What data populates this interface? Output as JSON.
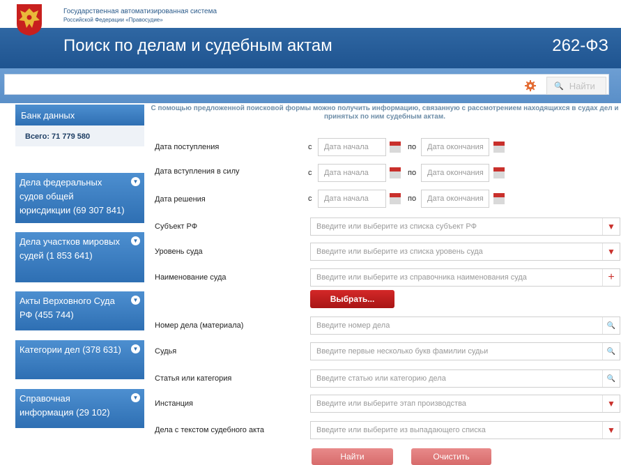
{
  "header": {
    "system_line1": "Государственная автоматизированная система",
    "system_line2": "Российской Федерации «Правосудие»",
    "title": "Поиск по делам и судебным актам",
    "law": "262-ФЗ"
  },
  "search": {
    "value": "",
    "find_label": "Найти",
    "colors": {
      "accent": "#c9302c",
      "title_bar": "#2a62a0",
      "sidebar": "#3a7dc2"
    }
  },
  "sidebar": {
    "header": "Банк данных",
    "total": "Всего: 71 779 580",
    "items": [
      {
        "label": "Дела федеральных судов общей юрисдикции (69 307 841)"
      },
      {
        "label": "Дела участков мировых судей (1 853 641)"
      },
      {
        "label": "Акты Верховного Суда РФ (455 744)"
      },
      {
        "label": "Категории дел (378 631)"
      },
      {
        "label": "Справочная информация (29 102)"
      }
    ]
  },
  "form": {
    "intro": "С помощью предложенной поисковой формы можно получить информацию, связанную с рассмотрением находящихся в судах дел и принятых по ним судебным актам.",
    "from": "с",
    "to": "по",
    "start_placeholder": "Дата начала",
    "end_placeholder": "Дата окончания",
    "date_rows": [
      {
        "label": "Дата поступления"
      },
      {
        "label": "Дата вступления в силу"
      },
      {
        "label": "Дата решения"
      }
    ],
    "fields": [
      {
        "label": "Субъект РФ",
        "placeholder": "Введите или выберите из списка субъект РФ",
        "icon": "dropdown-arrow"
      },
      {
        "label": "Уровень суда",
        "placeholder": "Введите или выберите из списка уровень суда",
        "icon": "dropdown-arrow"
      },
      {
        "label": "Наименование суда",
        "placeholder": "Введите или выберите из справочника наименования суда",
        "icon": "plus"
      },
      {
        "label": "Номер дела (материала)",
        "placeholder": "Введите номер дела",
        "icon": "search"
      },
      {
        "label": "Судья",
        "placeholder": "Введите первые несколько букв фамилии судьи",
        "icon": "search"
      },
      {
        "label": "Статья или категория",
        "placeholder": "Введите статью или категорию дела",
        "icon": "search"
      },
      {
        "label": "Инстанция",
        "placeholder": "Введите или выберите этап производства",
        "icon": "dropdown-arrow"
      },
      {
        "label": "Дела с текстом судебного акта",
        "placeholder": "Введите или выберите из выпадающего списка",
        "icon": "dropdown-arrow"
      }
    ],
    "choose_label": "Выбрать...",
    "find_label": "Найти",
    "clear_label": "Очистить"
  }
}
